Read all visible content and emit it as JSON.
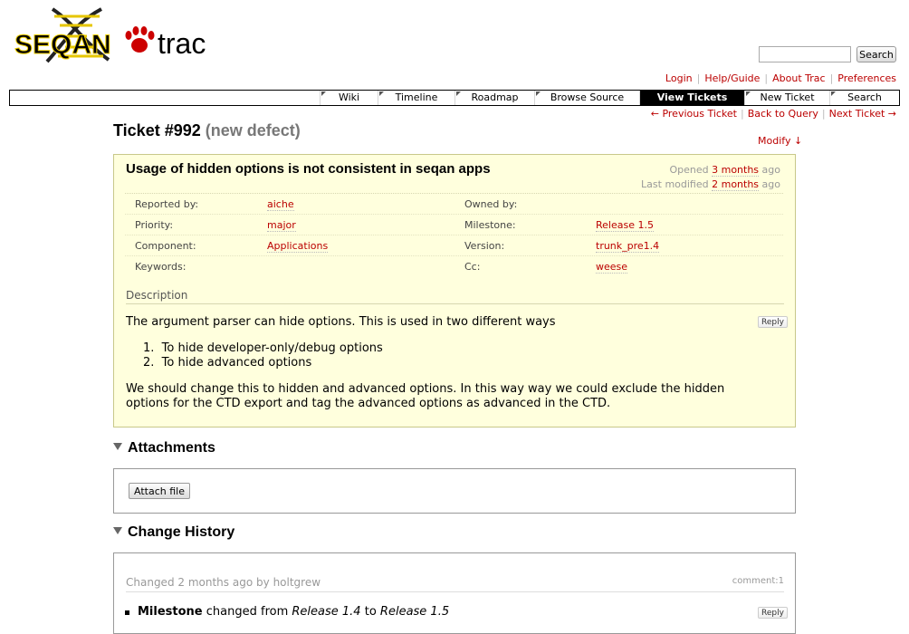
{
  "logo": {
    "seqan_text": "SEQAN",
    "trac_text": "trac"
  },
  "search": {
    "placeholder": "",
    "button_label": "Search"
  },
  "metanav": [
    "Login",
    "Help/Guide",
    "About Trac",
    "Preferences"
  ],
  "mainnav": [
    {
      "label": "Wiki",
      "active": false
    },
    {
      "label": "Timeline",
      "active": false
    },
    {
      "label": "Roadmap",
      "active": false
    },
    {
      "label": "Browse Source",
      "active": false
    },
    {
      "label": "View Tickets",
      "active": true
    },
    {
      "label": "New Ticket",
      "active": false
    },
    {
      "label": "Search",
      "active": false
    }
  ],
  "ctxtnav": {
    "prev": "← Previous Ticket",
    "back": "Back to Query",
    "next": "Next Ticket →"
  },
  "ticket": {
    "number": "Ticket #992",
    "status": "(new defect)",
    "modify": "Modify ↓",
    "summary": "Usage of hidden options is not consistent in seqan apps",
    "opened_prefix": "Opened",
    "opened_value": "3 months",
    "opened_suffix": "ago",
    "modified_prefix": "Last modified",
    "modified_value": "2 months",
    "modified_suffix": "ago",
    "props": {
      "reported_by_label": "Reported by:",
      "reported_by": "aiche",
      "owned_by_label": "Owned by:",
      "owned_by": "",
      "priority_label": "Priority:",
      "priority": "major",
      "milestone_label": "Milestone:",
      "milestone": "Release 1.5",
      "component_label": "Component:",
      "component": "Applications",
      "version_label": "Version:",
      "version": "trunk_pre1.4",
      "keywords_label": "Keywords:",
      "keywords": "",
      "cc_label": "Cc:",
      "cc": "weese"
    },
    "description_heading": "Description",
    "reply": "Reply",
    "description": {
      "intro": "The argument parser can hide options. This is used in two different ways",
      "items": [
        "To hide developer-only/debug options",
        "To hide advanced options"
      ],
      "body": "We should change this to hidden and advanced options. In this way way we could exclude the hidden options for the CTD export and tag the advanced options as advanced in the CTD."
    }
  },
  "attachments": {
    "heading": "Attachments",
    "attach_button": "Attach file"
  },
  "history": {
    "heading": "Change History",
    "entry_prefix": "Changed",
    "entry_time": "2 months",
    "entry_suffix": "ago by",
    "entry_author": "holtgrew",
    "comment_num": "comment:1",
    "reply": "Reply",
    "change_field": "Milestone",
    "change_from_text": "changed from",
    "change_from": "Release 1.4",
    "change_to_text": "to",
    "change_to": "Release 1.5"
  },
  "colors": {
    "accent": "#bb0000",
    "ticket_bg": "#ffffdd",
    "ticket_border": "#c8c88a"
  }
}
